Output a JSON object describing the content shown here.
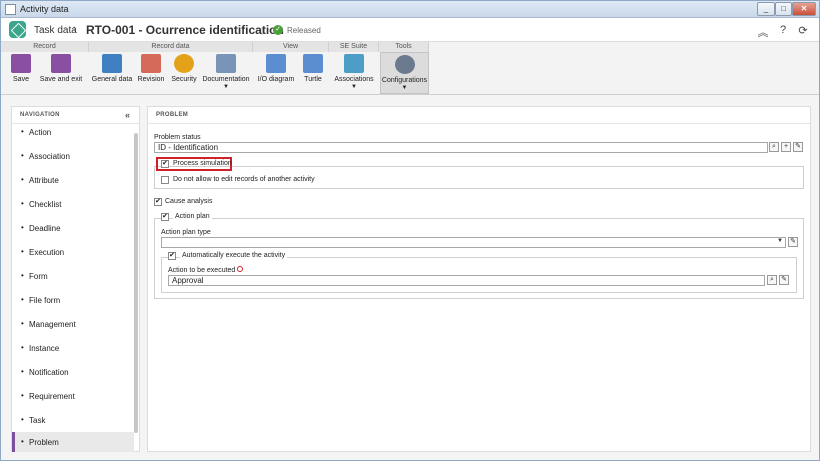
{
  "window": {
    "title": "Activity data"
  },
  "header": {
    "breadcrumb": "Task data",
    "record_title": "RTO-001 - Ocurrence identification",
    "status": "Released"
  },
  "ribbon": {
    "groups": [
      {
        "label": "Record"
      },
      {
        "label": "Record data"
      },
      {
        "label": "View"
      },
      {
        "label": "SE Suite"
      },
      {
        "label": "Tools"
      }
    ],
    "buttons": {
      "save": "Save",
      "save_exit": "Save and exit",
      "general_data": "General data",
      "revision": "Revision",
      "security": "Security",
      "documentation": "Documentation",
      "io_diagram": "I/O diagram",
      "turtle": "Turtle",
      "associations": "Associations",
      "configurations": "Configurations"
    }
  },
  "navigation": {
    "title": "NAVIGATION",
    "items": [
      "Action",
      "Association",
      "Attribute",
      "Checklist",
      "Deadline",
      "Execution",
      "Form",
      "File form",
      "Management",
      "Instance",
      "Notification",
      "Requirement",
      "Task",
      "Problem"
    ],
    "selected": "Problem"
  },
  "problem": {
    "title": "PROBLEM",
    "status_label": "Problem status",
    "status_value": "ID - Identification",
    "process_simulation": {
      "label": "Process simulation",
      "checked": true
    },
    "no_edit_other": {
      "label": "Do not allow to edit records of another activity",
      "checked": false
    },
    "cause_analysis": {
      "label": "Cause analysis",
      "checked": true
    },
    "action_plan": {
      "label": "Action plan",
      "checked": true
    },
    "action_plan_type_label": "Action plan type",
    "action_plan_type_value": "",
    "auto_execute": {
      "label": "Automatically execute the activity",
      "checked": true
    },
    "action_exec_label": "Action to be executed",
    "action_exec_value": "Approval"
  },
  "colors": {
    "accent": "#7b4e9e",
    "highlight": "#d0202a",
    "released": "#4c9e3b"
  }
}
